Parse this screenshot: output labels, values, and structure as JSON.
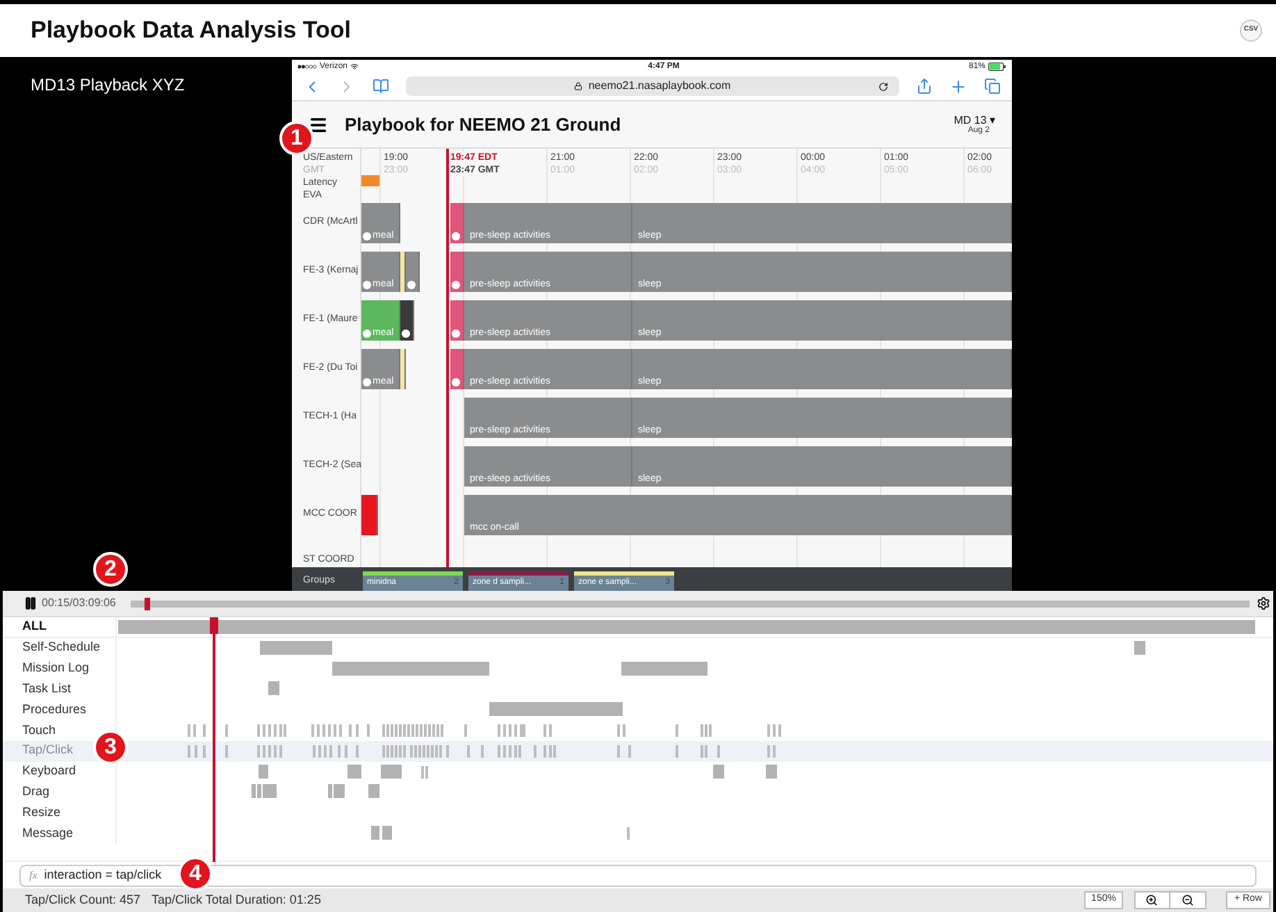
{
  "header": {
    "title": "Playbook Data Analysis Tool",
    "csv_button": "CSV"
  },
  "session_label": "MD13 Playback XYZ",
  "ipad": {
    "status_bar": {
      "carrier": "Verizon",
      "time": "4:47 PM",
      "battery": "81%"
    },
    "url": "neemo21.nasaplaybook.com",
    "title": "Playbook for NEEMO 21 Ground",
    "day": "MD 13 ▾",
    "date": "Aug 2",
    "timezones": [
      "US/Eastern",
      "GMT"
    ],
    "extra_rows": [
      "Latency",
      "EVA"
    ],
    "now": {
      "local": "19:47 EDT",
      "gmt": "23:47 GMT"
    },
    "hours": [
      {
        "local": "19:00",
        "gmt": "23:00"
      },
      {
        "local": "21:00",
        "gmt": "01:00"
      },
      {
        "local": "22:00",
        "gmt": "02:00"
      },
      {
        "local": "23:00",
        "gmt": "03:00"
      },
      {
        "local": "00:00",
        "gmt": "04:00"
      },
      {
        "local": "01:00",
        "gmt": "05:00"
      },
      {
        "local": "02:00",
        "gmt": "06:00"
      }
    ],
    "crew": [
      {
        "name": "CDR (McArtl",
        "activities": [
          {
            "label": "meal",
            "color": "#8a8c8e",
            "marker": true
          },
          {
            "color": "#e0567a",
            "marker": true
          },
          {
            "label": "pre-sleep activities",
            "color": "#8a8c8e",
            "marker": false
          },
          {
            "label": "sleep",
            "color": "#8a8c8e",
            "marker": false
          }
        ]
      },
      {
        "name": "FE-3 (Kernaj",
        "activities": [
          {
            "label": "meal",
            "color": "#8a8c8e",
            "marker": true
          },
          {
            "color": "#f5e6a0",
            "marker": false
          },
          {
            "color": "#8a8c8e",
            "marker": true
          },
          {
            "color": "#e0567a",
            "marker": true
          },
          {
            "label": "pre-sleep activities",
            "color": "#8a8c8e",
            "marker": false
          },
          {
            "label": "sleep",
            "color": "#8a8c8e",
            "marker": false
          }
        ]
      },
      {
        "name": "FE-1 (Maure",
        "activities": [
          {
            "label": "meal",
            "color": "#5cb85c",
            "marker": true
          },
          {
            "color": "#3a3a3c",
            "marker": true
          },
          {
            "color": "#e0567a",
            "marker": true
          },
          {
            "label": "pre-sleep activities",
            "color": "#8a8c8e",
            "marker": false
          },
          {
            "label": "sleep",
            "color": "#8a8c8e",
            "marker": false
          }
        ]
      },
      {
        "name": "FE-2 (Du Toi",
        "activities": [
          {
            "label": "meal",
            "color": "#8a8c8e",
            "marker": true
          },
          {
            "color": "#f5e6a0",
            "marker": false
          },
          {
            "color": "#e0567a",
            "marker": true
          },
          {
            "label": "pre-sleep activities",
            "color": "#8a8c8e",
            "marker": false
          },
          {
            "label": "sleep",
            "color": "#8a8c8e",
            "marker": false
          }
        ]
      },
      {
        "name": "TECH-1 (Ha",
        "activities": [
          {
            "label": "pre-sleep activities",
            "color": "#8a8c8e",
            "marker": false
          },
          {
            "label": "sleep",
            "color": "#8a8c8e",
            "marker": false
          }
        ]
      },
      {
        "name": "TECH-2 (Sea",
        "activities": [
          {
            "label": "pre-sleep activities",
            "color": "#8a8c8e",
            "marker": false
          },
          {
            "label": "sleep",
            "color": "#8a8c8e",
            "marker": false
          }
        ]
      },
      {
        "name": "MCC COOR",
        "activities": [
          {
            "color": "#e8141e",
            "marker": false
          },
          {
            "label": "mcc on-call",
            "color": "#8a8c8e",
            "marker": false
          }
        ]
      },
      {
        "name": "ST COORD"
      }
    ],
    "groups_label": "Groups",
    "groups": [
      {
        "label": "minidna",
        "count": "2",
        "color": "#7ed957"
      },
      {
        "label": "zone d sampli...",
        "count": "1",
        "color": "#8b1a4a"
      },
      {
        "label": "zone e sampli...",
        "count": "3",
        "color": "#f0e68c"
      }
    ]
  },
  "playback": {
    "playing": true,
    "time": "00:15/03:09:06",
    "level": 0.013
  },
  "timeline": {
    "cursor": {
      "level": 0.083
    },
    "rows": [
      {
        "label": "ALL",
        "kind": "all",
        "selected": false
      },
      {
        "label": "Self-Schedule",
        "kind": "event",
        "selected": false
      },
      {
        "label": "Mission Log",
        "kind": "event",
        "selected": false
      },
      {
        "label": "Task List",
        "kind": "event",
        "selected": false
      },
      {
        "label": "Procedures",
        "kind": "event",
        "selected": false
      },
      {
        "label": "Touch",
        "kind": "event",
        "selected": false
      },
      {
        "label": "Tap/Click",
        "kind": "event",
        "selected": true
      },
      {
        "label": "Keyboard",
        "kind": "event",
        "selected": false
      },
      {
        "label": "Drag",
        "kind": "event",
        "selected": false
      },
      {
        "label": "Resize",
        "kind": "event",
        "selected": false
      },
      {
        "label": "Message",
        "kind": "event",
        "selected": false
      }
    ]
  },
  "formula": {
    "prefix": "fx",
    "expression": "interaction = tap/click"
  },
  "status_bar": {
    "count": "Tap/Click Count: 457",
    "duration": "Tap/Click Total Duration: 01:25",
    "zoom": "150%",
    "add_row": "+ Row"
  },
  "annotations": [
    "1",
    "2",
    "3",
    "4"
  ]
}
